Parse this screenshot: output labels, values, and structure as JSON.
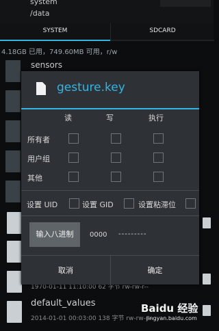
{
  "topbar": {
    "title": "system",
    "path": "/data",
    "corner": ""
  },
  "tabs": [
    {
      "label": "SYSTEM"
    },
    {
      "label": "SDCARD"
    }
  ],
  "storage_info": "4.18GB 已用，749.60MB 可用，r/w",
  "background_rows": [
    {
      "label": "sensors"
    }
  ],
  "bottom": {
    "meta_above": "1970-01-11 11:10:00 62 字节  rw-rw-r--",
    "name": "default_values",
    "meta_below": "2014-01-01 00:03:00 138 字节  rw-rw-r--"
  },
  "watermark": {
    "text": "Baidu 经验",
    "sub": "jingyan.baidu.com"
  },
  "dialog": {
    "title": "gesture.key",
    "columns": [
      "读",
      "写",
      "执行"
    ],
    "rows": [
      {
        "label": "所有者",
        "read": false,
        "write": false,
        "exec": false
      },
      {
        "label": "用户组",
        "read": false,
        "write": false,
        "exec": false
      },
      {
        "label": "其他",
        "read": false,
        "write": false,
        "exec": false
      }
    ],
    "options": [
      {
        "label": "设置 UID",
        "checked": false
      },
      {
        "label": "设置 GID",
        "checked": false
      },
      {
        "label": "设置粘滞位",
        "checked": false
      }
    ],
    "octal_button": "输入八进制",
    "octal_value": "0000",
    "permission_string": "---------",
    "cancel": "取消",
    "ok": "确定"
  },
  "colors": {
    "accent": "#33b5e5",
    "dialog_bg": "#2e3236",
    "page_bg": "#0b0d0e"
  },
  "icons": [
    "document-icon",
    "file-icon",
    "folder-icon"
  ]
}
